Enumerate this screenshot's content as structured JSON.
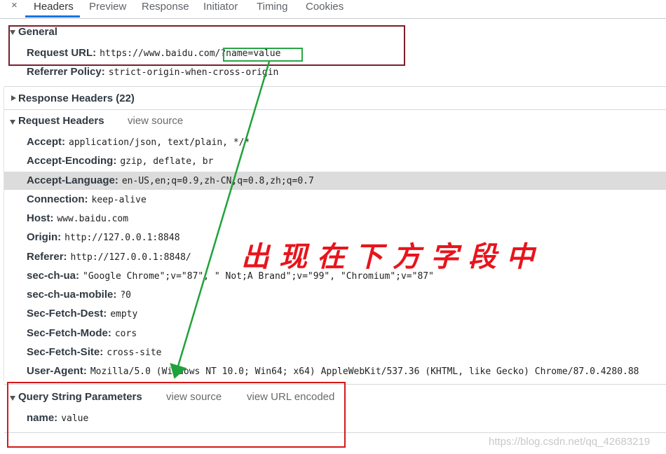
{
  "tabbar": {
    "close": "×",
    "tabs": [
      "Headers",
      "Preview",
      "Response",
      "Initiator",
      "Timing",
      "Cookies"
    ],
    "active": "Headers"
  },
  "general": {
    "title": "General",
    "request_url_key": "Request URL:",
    "request_url_base": "https://www.baidu.com/",
    "request_url_query": "?name=value",
    "referrer_policy_key": "Referrer Policy:",
    "referrer_policy_val": "strict-origin-when-cross-origin"
  },
  "response_headers": {
    "title": "Response Headers (22)"
  },
  "request_headers": {
    "title": "Request Headers",
    "view_source": "view source",
    "rows": [
      {
        "key": "Accept:",
        "val": "application/json, text/plain, */*"
      },
      {
        "key": "Accept-Encoding:",
        "val": "gzip, deflate, br"
      },
      {
        "key": "Accept-Language:",
        "val": "en-US,en;q=0.9,zh-CN;q=0.8,zh;q=0.7"
      },
      {
        "key": "Connection:",
        "val": "keep-alive"
      },
      {
        "key": "Host:",
        "val": "www.baidu.com"
      },
      {
        "key": "Origin:",
        "val": "http://127.0.0.1:8848"
      },
      {
        "key": "Referer:",
        "val": "http://127.0.0.1:8848/"
      },
      {
        "key": "sec-ch-ua:",
        "val": "\"Google Chrome\";v=\"87\", \" Not;A Brand\";v=\"99\", \"Chromium\";v=\"87\""
      },
      {
        "key": "sec-ch-ua-mobile:",
        "val": "?0"
      },
      {
        "key": "Sec-Fetch-Dest:",
        "val": "empty"
      },
      {
        "key": "Sec-Fetch-Mode:",
        "val": "cors"
      },
      {
        "key": "Sec-Fetch-Site:",
        "val": "cross-site"
      },
      {
        "key": "User-Agent:",
        "val": "Mozilla/5.0 (Windows NT 10.0; Win64; x64) AppleWebKit/537.36 (KHTML, like Gecko) Chrome/87.0.4280.88"
      }
    ]
  },
  "query_params": {
    "title": "Query String Parameters",
    "view_source": "view source",
    "view_url_encoded": "view URL encoded",
    "name_key": "name:",
    "name_val": "value"
  },
  "annotation": "出现在下方字段中",
  "watermark": "https://blog.csdn.net/qq_42683219",
  "colors": {
    "annotation_red": "#e8141c",
    "box_red": "#d51818",
    "box_dark_red": "#7a1e2c",
    "box_green": "#28a745",
    "arrow_green": "#1fa23a",
    "tab_accent": "#1a73e8"
  }
}
